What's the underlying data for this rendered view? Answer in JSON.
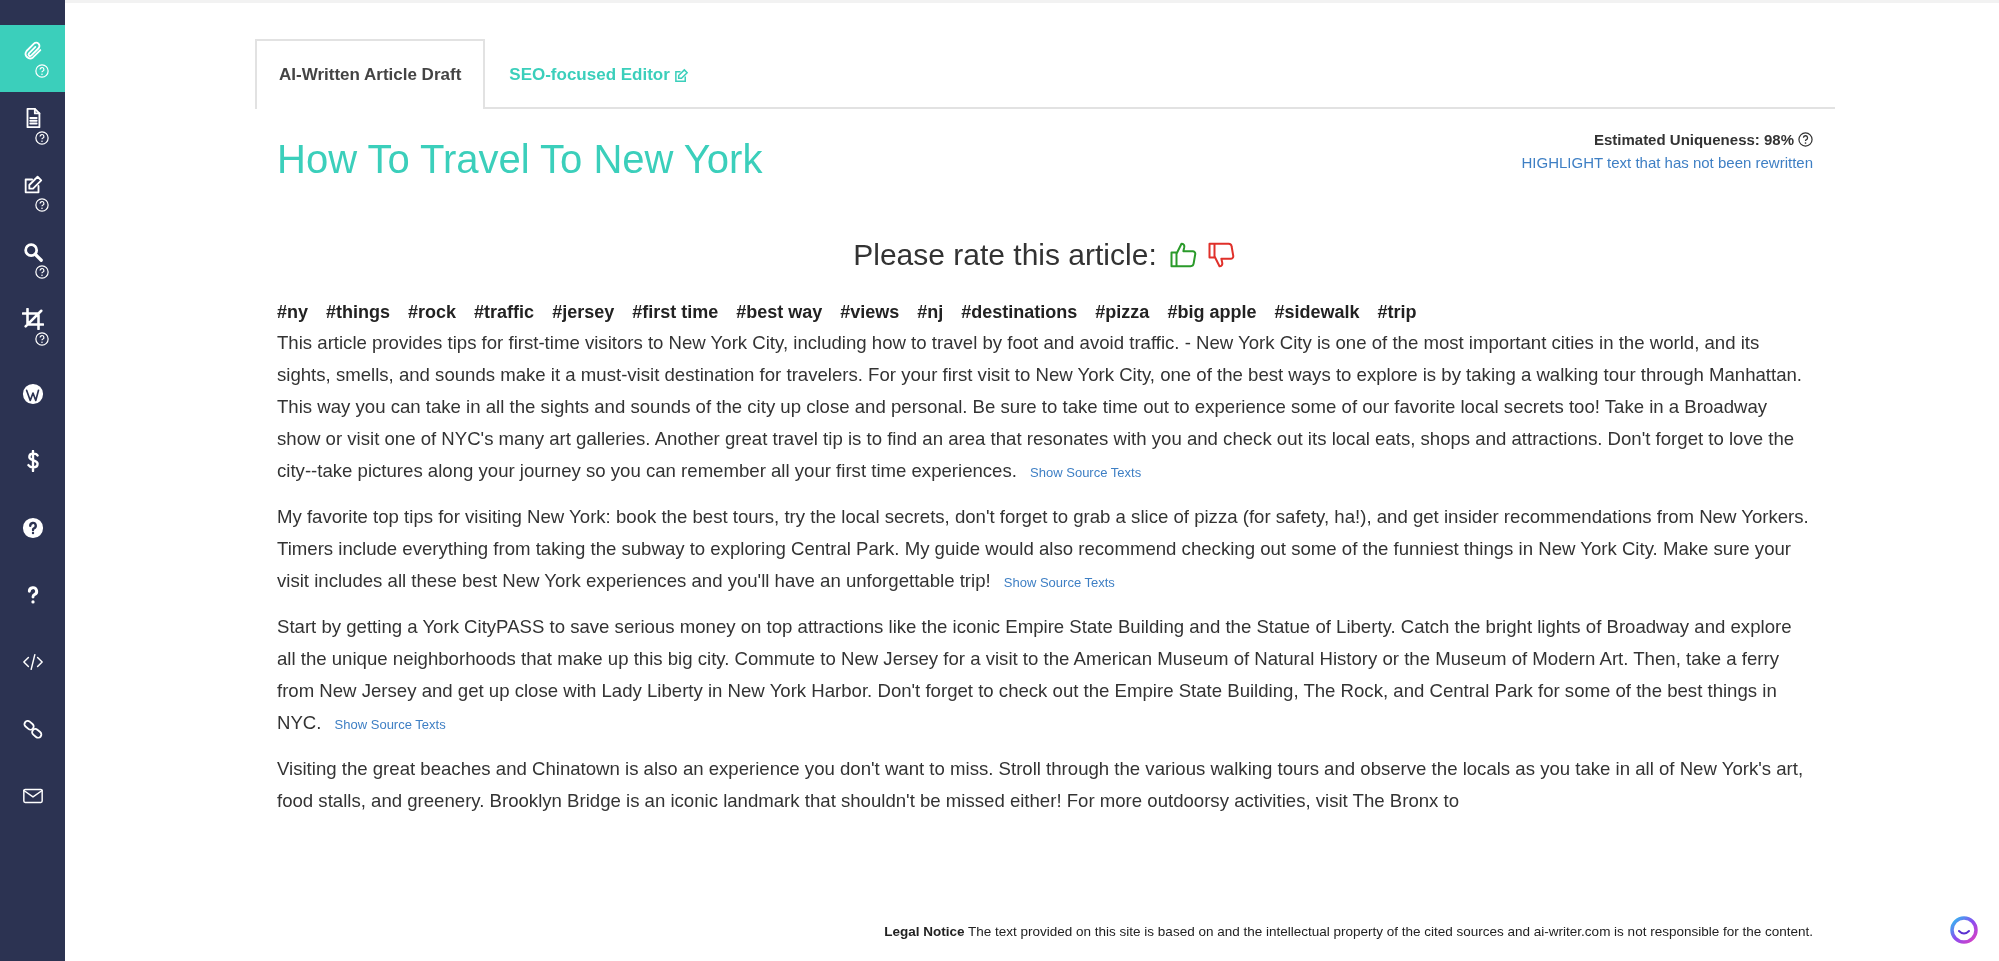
{
  "sidebar": {
    "items": [
      {
        "kind": "paperclip",
        "selected": true,
        "help": true
      },
      {
        "kind": "document",
        "selected": false,
        "help": true
      },
      {
        "kind": "edit",
        "selected": false,
        "help": true
      },
      {
        "kind": "search",
        "selected": false,
        "help": true
      },
      {
        "kind": "crop",
        "selected": false,
        "help": true
      },
      {
        "kind": "wordpress",
        "selected": false,
        "help": false
      },
      {
        "kind": "dollar",
        "selected": false,
        "help": false
      },
      {
        "kind": "help",
        "selected": false,
        "help": false
      },
      {
        "kind": "question",
        "selected": false,
        "help": false
      },
      {
        "kind": "code",
        "selected": false,
        "help": false
      },
      {
        "kind": "link",
        "selected": false,
        "help": false
      },
      {
        "kind": "envelope",
        "selected": false,
        "help": false
      }
    ]
  },
  "tabs": [
    {
      "label": "AI-Written Article Draft",
      "selected": true,
      "kind": "plain"
    },
    {
      "label": "SEO-focused Editor",
      "selected": false,
      "kind": "editor"
    }
  ],
  "article": {
    "title": "How To Travel To New York",
    "uniqueness": "Estimated Uniqueness: 98%",
    "highlight_link": "HIGHLIGHT text that has not been rewritten",
    "rate_prompt": "Please rate this article:",
    "tags": [
      "#ny",
      "#things",
      "#rock",
      "#traffic",
      "#jersey",
      "#first time",
      "#best way",
      "#views",
      "#nj",
      "#destinations",
      "#pizza",
      "#big apple",
      "#sidewalk",
      "#trip"
    ],
    "paragraphs": [
      {
        "text": "This article provides tips for first-time visitors to New York City, including how to travel by foot and avoid traffic. - New York City is one of the most important cities in the world, and its sights, smells, and sounds make it a must-visit destination for travelers. For your first visit to New York City, one of the best ways to explore is by taking a walking tour through Manhattan. This way you can take in all the sights and sounds of the city up close and personal. Be sure to take time out to experience some of our favorite local secrets too! Take in a Broadway show or visit one of NYC's many art galleries. Another great travel tip is to find an area that resonates with you and check out its local eats, shops and attractions. Don't forget to love the city--take pictures along your journey so you can remember all your first time experiences.",
        "source_link": "Show Source Texts"
      },
      {
        "text": "My favorite top tips for visiting New York: book the best tours, try the local secrets, don't forget to grab a slice of pizza (for safety, ha!), and get insider recommendations from New Yorkers. Timers include everything from taking the subway to exploring Central Park. My guide would also recommend checking out some of the funniest things in New York City. Make sure your visit includes all these best New York experiences and you'll have an unforgettable trip!",
        "source_link": "Show Source Texts"
      },
      {
        "text": "Start by getting a York CityPASS to save serious money on top attractions like the iconic Empire State Building and the Statue of Liberty. Catch the bright lights of Broadway and explore all the unique neighborhoods that make up this big city. Commute to New Jersey for a visit to the American Museum of Natural History or the Museum of Modern Art. Then, take a ferry from New Jersey and get up close with Lady Liberty in New York Harbor. Don't forget to check out the Empire State Building, The Rock, and Central Park for some of the best things in NYC.",
        "source_link": "Show Source Texts"
      },
      {
        "text": "Visiting the great beaches and Chinatown is also an experience you don't want to miss. Stroll through the various walking tours and observe the locals as you take in all of New York's art, food stalls, and greenery. Brooklyn Bridge is an iconic landmark that shouldn't be missed either! For more outdoorsy activities, visit The Bronx to"
      }
    ]
  },
  "legal_notice": {
    "label": "Legal Notice",
    "text": "The text provided on this site is based on and the intellectual property of the cited sources and ai-writer.com is not responsible for the content."
  }
}
